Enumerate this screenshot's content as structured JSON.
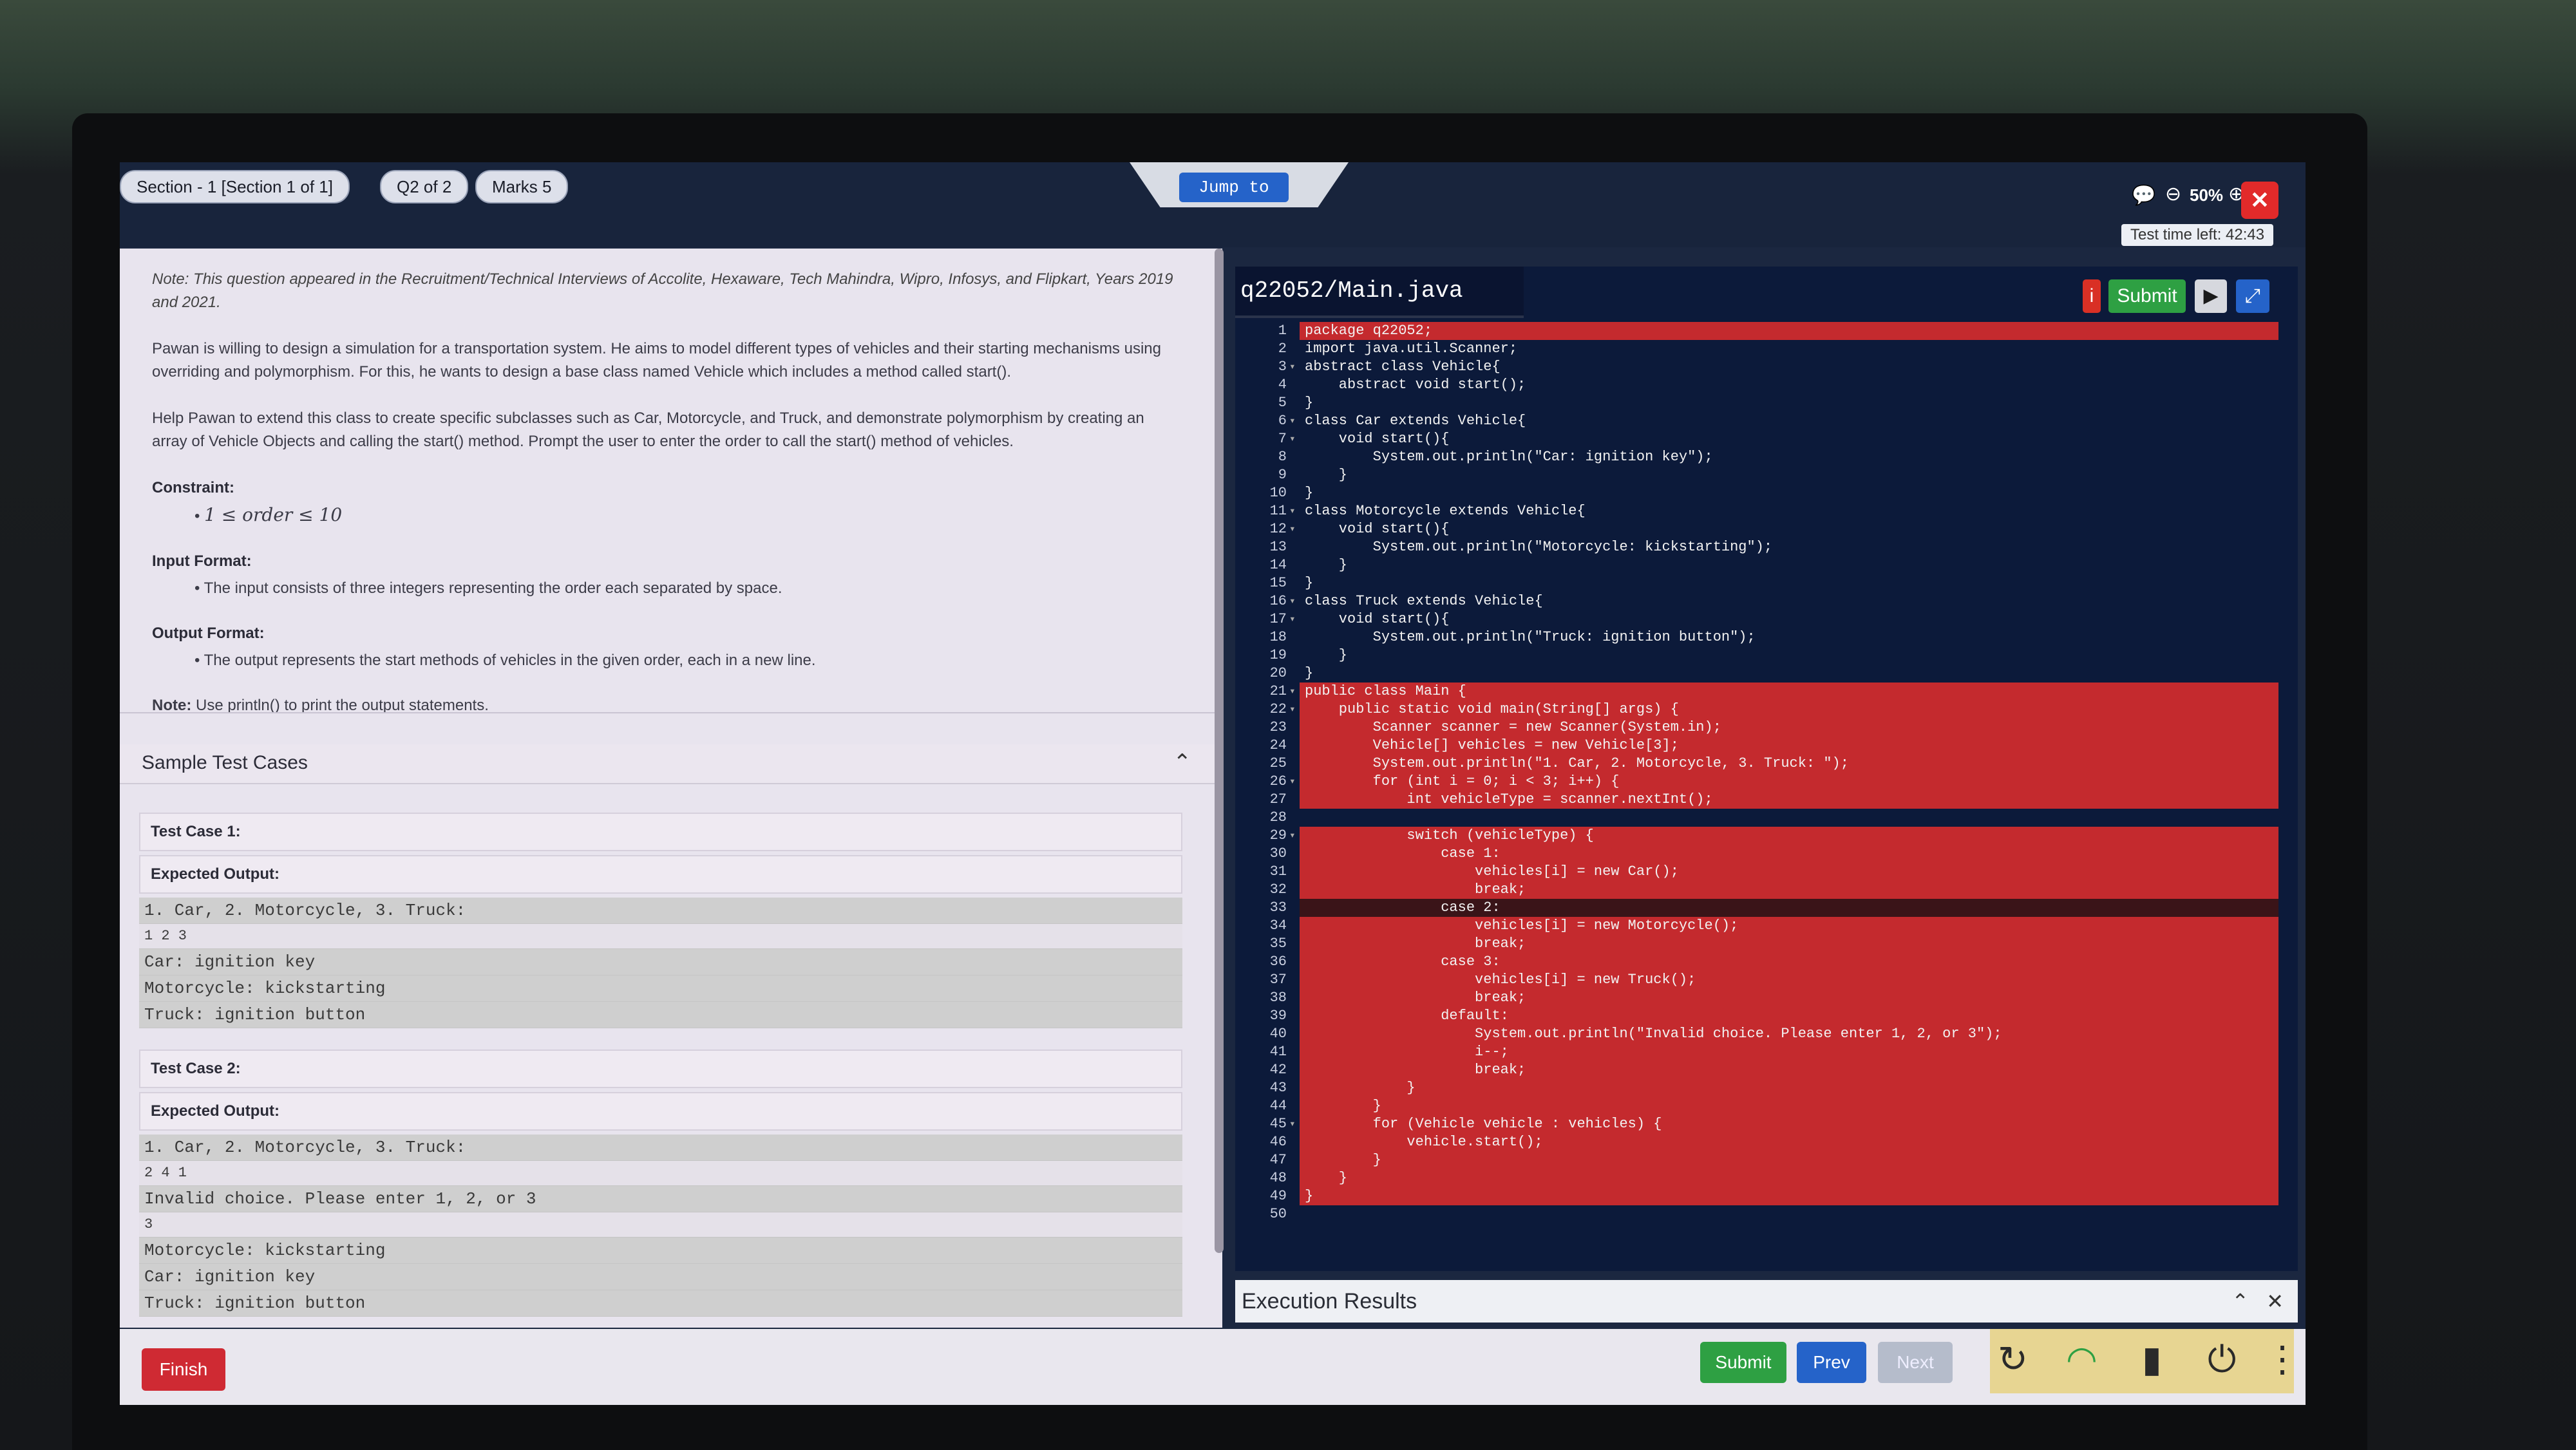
{
  "header": {
    "section": "Section - 1 [Section 1 of 1]",
    "question": "Q2 of 2",
    "marks": "Marks 5",
    "jump": "Jump to",
    "zoom": "50%",
    "timer": "Test time left: 42:43",
    "close": "✕"
  },
  "question": {
    "note": "Note: This question appeared in the Recruitment/Technical Interviews of Accolite, Hexaware, Tech Mahindra, Wipro, Infosys, and Flipkart, Years 2019 and 2021.",
    "para1": "Pawan is willing to design a simulation for a transportation system. He aims to model different types of vehicles and their starting mechanisms using overriding and polymorphism. For this, he wants to design a base class named Vehicle which includes a method called start().",
    "para2": "Help Pawan to extend this class to create specific subclasses such as Car, Motorcycle, and Truck, and demonstrate polymorphism by creating an array of Vehicle Objects and calling the start() method. Prompt the user to enter the order to call the start() method of vehicles.",
    "constraint_label": "Constraint:",
    "constraint": "1 ≤ order ≤ 10",
    "input_label": "Input Format:",
    "input": "The input consists of three integers representing the order each separated by space.",
    "output_label": "Output Format:",
    "output": "The output represents the start methods of vehicles in the given order, each in a new line.",
    "note2_label": "Note:",
    "note2": "Use println() to print the output statements."
  },
  "samples": {
    "title": "Sample Test Cases",
    "tc1": {
      "label": "Test Case 1:",
      "expected": "Expected Output:",
      "lines": [
        "1. Car, 2. Motorcycle, 3. Truck: ",
        "1 2 3",
        "Car: ignition key",
        "Motorcycle: kickstarting",
        "Truck: ignition button"
      ]
    },
    "tc2": {
      "label": "Test Case 2:",
      "expected": "Expected Output:",
      "lines": [
        "1. Car, 2. Motorcycle, 3. Truck: ",
        "2 4 1",
        "Invalid choice. Please enter 1, 2, or 3",
        "3",
        "Motorcycle: kickstarting",
        "Car: ignition key",
        "Truck: ignition button"
      ]
    }
  },
  "editor": {
    "filename": "q22052/Main.java",
    "submit": "Submit",
    "info": "i",
    "run": "▶",
    "expand": "⤢",
    "lines": [
      "package q22052;",
      "import java.util.Scanner;",
      "abstract class Vehicle{",
      "    abstract void start();",
      "}",
      "class Car extends Vehicle{",
      "    void start(){",
      "        System.out.println(\"Car: ignition key\");",
      "    }",
      "}",
      "class Motorcycle extends Vehicle{",
      "    void start(){",
      "        System.out.println(\"Motorcycle: kickstarting\");",
      "    }",
      "}",
      "class Truck extends Vehicle{",
      "    void start(){",
      "        System.out.println(\"Truck: ignition button\");",
      "    }",
      "}",
      "public class Main {",
      "    public static void main(String[] args) {",
      "        Scanner scanner = new Scanner(System.in);",
      "        Vehicle[] vehicles = new Vehicle[3];",
      "        System.out.println(\"1. Car, 2. Motorcycle, 3. Truck: \");",
      "        for (int i = 0; i < 3; i++) {",
      "            int vehicleType = scanner.nextInt();",
      "",
      "            switch (vehicleType) {",
      "                case 1:",
      "                    vehicles[i] = new Car();",
      "                    break;",
      "                case 2:",
      "                    vehicles[i] = new Motorcycle();",
      "                    break;",
      "                case 3:",
      "                    vehicles[i] = new Truck();",
      "                    break;",
      "                default:",
      "                    System.out.println(\"Invalid choice. Please enter 1, 2, or 3\");",
      "                    i--;",
      "                    break;",
      "            }",
      "        }",
      "        for (Vehicle vehicle : vehicles) {",
      "            vehicle.start();",
      "        }",
      "    }",
      "}",
      ""
    ]
  },
  "execution": {
    "title": "Execution Results",
    "collapse": "⌃",
    "close": "✕"
  },
  "footer": {
    "finish": "Finish",
    "submit": "Submit",
    "prev": "Prev",
    "next": "Next"
  },
  "colors": {
    "accent": "#2563c9",
    "success": "#2ea043",
    "danger": "#cf2a33",
    "error_highlight": "#c42a2e"
  }
}
